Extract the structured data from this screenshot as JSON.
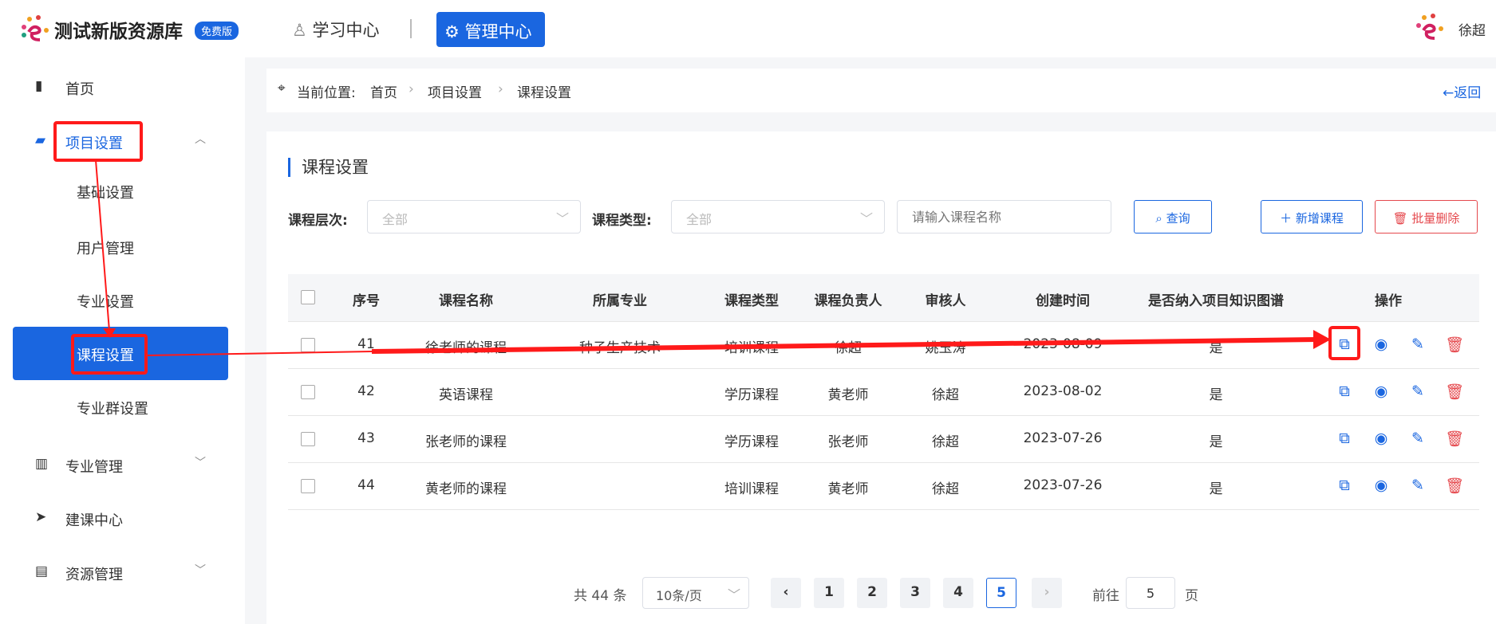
{
  "header": {
    "brand": "测试新版资源库",
    "badge": "免费版",
    "nav_learning": "学习中心",
    "nav_admin": "管理中心",
    "user": "徐超"
  },
  "sidebar": {
    "items": [
      {
        "label": "首页",
        "icon": "building-icon"
      },
      {
        "label": "项目设置",
        "icon": "folder-icon",
        "expanded": true
      },
      {
        "label": "基础设置"
      },
      {
        "label": "用户管理"
      },
      {
        "label": "专业设置"
      },
      {
        "label": "课程设置",
        "active": true
      },
      {
        "label": "专业群设置"
      },
      {
        "label": "专业管理",
        "icon": "book-icon"
      },
      {
        "label": "建课中心",
        "icon": "send-icon"
      },
      {
        "label": "资源管理",
        "icon": "inbox-icon"
      }
    ]
  },
  "breadcrumb": {
    "prefix": "当前位置:",
    "items": [
      "首页",
      "项目设置",
      "课程设置"
    ],
    "back": "←返回"
  },
  "main": {
    "title": "课程设置",
    "filters": {
      "level_label": "课程层次:",
      "level_value": "全部",
      "type_label": "课程类型:",
      "type_value": "全部",
      "name_placeholder": "请输入课程名称",
      "query": "查询",
      "add": "新增课程",
      "batch_delete": "批量删除"
    },
    "table": {
      "headers": [
        "序号",
        "课程名称",
        "所属专业",
        "课程类型",
        "课程负责人",
        "审核人",
        "创建时间",
        "是否纳入项目知识图谱",
        "操作"
      ],
      "rows": [
        [
          "41",
          "徐老师的课程",
          "种子生产技术",
          "培训课程",
          "徐超",
          "姚玉涛",
          "2023-08-09",
          "是"
        ],
        [
          "42",
          "英语课程",
          "",
          "学历课程",
          "黄老师",
          "徐超",
          "2023-08-02",
          "是"
        ],
        [
          "43",
          "张老师的课程",
          "",
          "学历课程",
          "张老师",
          "徐超",
          "2023-07-26",
          "是"
        ],
        [
          "44",
          "黄老师的课程",
          "",
          "培训课程",
          "黄老师",
          "徐超",
          "2023-07-26",
          "是"
        ]
      ]
    },
    "pagination": {
      "total": "共 44 条",
      "page_size": "10条/页",
      "pages": [
        "1",
        "2",
        "3",
        "4",
        "5"
      ],
      "current": "5",
      "goto_label": "前往",
      "goto_value": "5",
      "goto_suffix": "页"
    }
  },
  "colors": {
    "primary": "#1a66e0",
    "danger": "#e5484d",
    "annotation": "#ff1a1a"
  }
}
